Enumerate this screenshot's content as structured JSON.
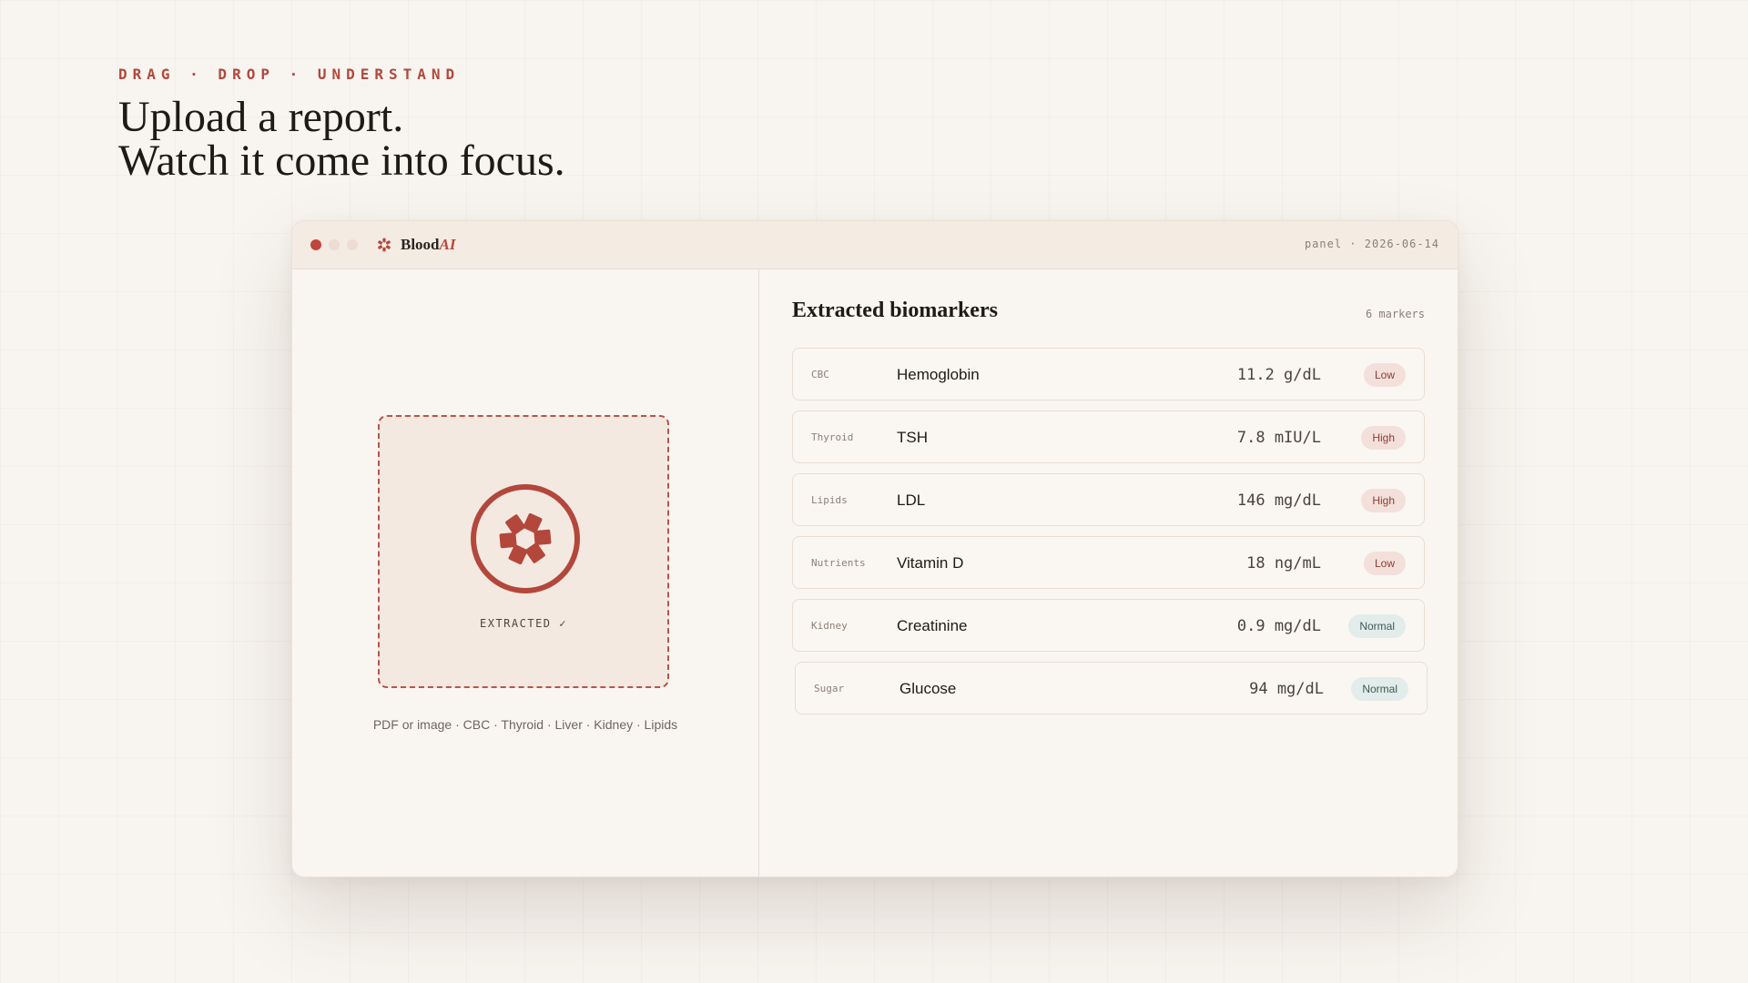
{
  "hero": {
    "eyebrow": "DRAG · DROP · UNDERSTAND",
    "headline_line1": "Upload a report.",
    "headline_line2": "Watch it come into focus."
  },
  "window": {
    "traffic_lights": [
      "#c0453b",
      "#e8d6cc",
      "#e8d6cc"
    ],
    "brand_prefix": "Blood",
    "brand_accent": "AI",
    "meta": "panel · 2026-06-14"
  },
  "upload": {
    "status": "EXTRACTED ✓",
    "formats": "PDF or image · CBC · Thyroid · Liver · Kidney · Lipids",
    "icon": "flower-icon"
  },
  "biomarkers": {
    "title": "Extracted biomarkers",
    "count": "6 markers",
    "rows": [
      {
        "category": "CBC",
        "name": "Hemoglobin",
        "value": "11.2 g/dL",
        "status": "Low"
      },
      {
        "category": "Thyroid",
        "name": "TSH",
        "value": "7.8 mIU/L",
        "status": "High"
      },
      {
        "category": "Lipids",
        "name": "LDL",
        "value": "146 mg/dL",
        "status": "High"
      },
      {
        "category": "Nutrients",
        "name": "Vitamin D",
        "value": "18 ng/mL",
        "status": "Low"
      },
      {
        "category": "Kidney",
        "name": "Creatinine",
        "value": "0.9 mg/dL",
        "status": "Normal"
      },
      {
        "category": "Sugar",
        "name": "Glucose",
        "value": "94 mg/dL",
        "status": "Normal"
      }
    ]
  },
  "colors": {
    "accent": "#b3473c",
    "low_high_badge": "#f3e0da",
    "normal_badge": "#e2ecea"
  }
}
